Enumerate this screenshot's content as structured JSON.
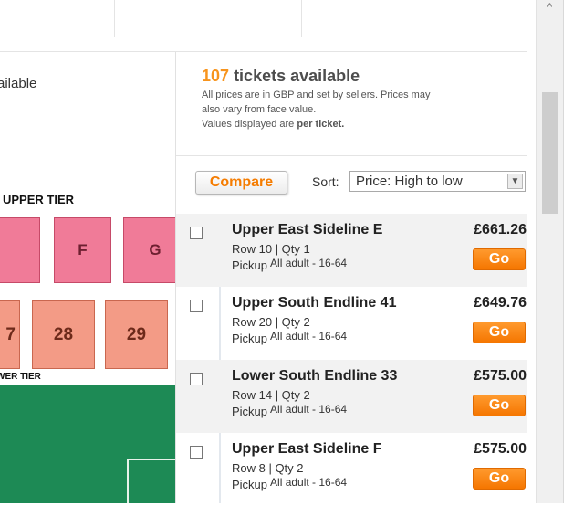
{
  "map": {
    "availability_fragment": "ailable",
    "upper_tier_label": "UPPER TIER",
    "lower_tier_label": "WER TIER",
    "blocks": [
      "F",
      "G",
      "7",
      "28",
      "29"
    ],
    "colors": {
      "upper_block": "#f07b98",
      "lower_block": "#f39b86",
      "pitch": "#1d8a55"
    }
  },
  "summary": {
    "count": "107",
    "title_suffix": "tickets available",
    "note_line1": "All prices are in GBP and set by sellers. Prices may",
    "note_line2": "also vary from face value.",
    "note_line3_prefix": "Values displayed are",
    "note_line3_bold": "per ticket."
  },
  "toolbar": {
    "compare_label": "Compare",
    "sort_label": "Sort:",
    "sort_value": "Price: High to low"
  },
  "tickets": [
    {
      "name": "Upper East Sideline E",
      "meta": "Row 10 | Qty 1",
      "pickup": "Pickup",
      "desc": "All adult - 16-64",
      "price": "£661.26",
      "go": "Go"
    },
    {
      "name": "Upper South Endline 41",
      "meta": "Row 20 | Qty 2",
      "pickup": "Pickup",
      "desc": "All adult - 16-64",
      "price": "£649.76",
      "go": "Go"
    },
    {
      "name": "Lower South Endline 33",
      "meta": "Row 14 | Qty 2",
      "pickup": "Pickup",
      "desc": "All adult - 16-64",
      "price": "£575.00",
      "go": "Go"
    },
    {
      "name": "Upper East Sideline F",
      "meta": "Row 8 | Qty 2",
      "pickup": "Pickup",
      "desc": "All adult - 16-64",
      "price": "£575.00",
      "go": "Go"
    }
  ],
  "colors": {
    "accent": "#f7941d",
    "go_button": "#f57600"
  }
}
